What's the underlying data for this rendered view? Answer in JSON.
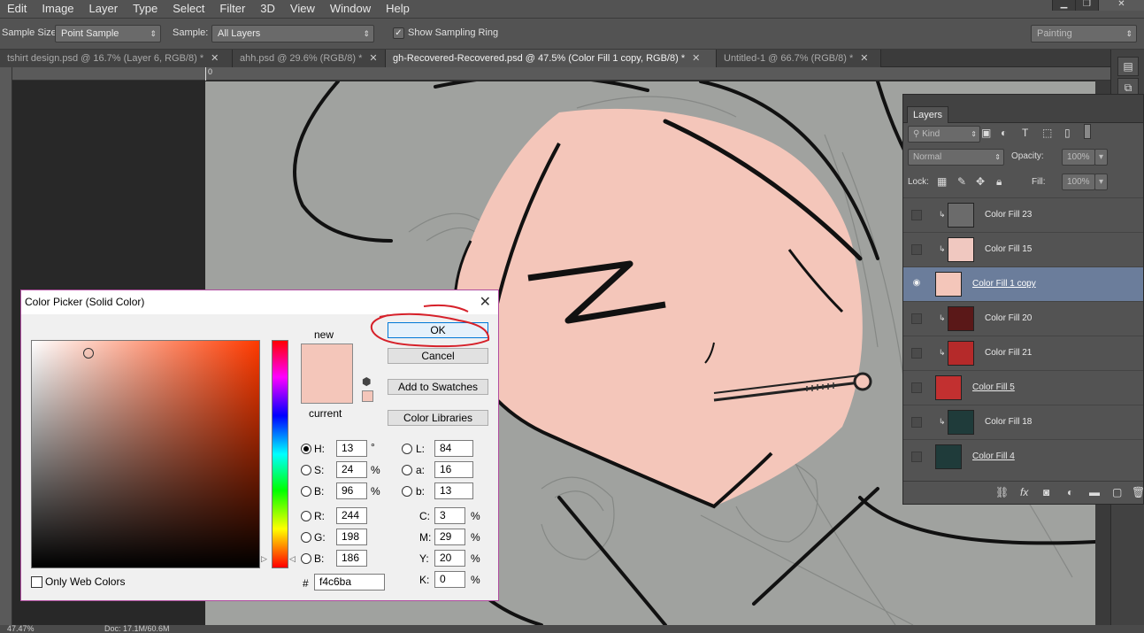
{
  "menu": [
    "Edit",
    "Image",
    "Layer",
    "Type",
    "Select",
    "Filter",
    "3D",
    "View",
    "Window",
    "Help"
  ],
  "options": {
    "sample_size_label": "Sample Size:",
    "sample_size_value": "Point Sample",
    "sample_label": "Sample:",
    "sample_value": "All Layers",
    "show_ring_label": "Show Sampling Ring",
    "workspace_value": "Painting"
  },
  "tabs": [
    "tshirt design.psd @ 16.7% (Layer 6, RGB/8) *",
    "ahh.psd @ 29.6% (RGB/8) *",
    "gh-Recovered-Recovered.psd @ 47.5% (Color Fill 1 copy, RGB/8) *",
    "Untitled-1 @ 66.7% (RGB/8) *"
  ],
  "ruler": {
    "zero": "0"
  },
  "status": {
    "zoom": "47.47%",
    "doc": "Doc: 17.1M/60.6M"
  },
  "layers_panel": {
    "tab": "Layers",
    "filter_kind": "Kind",
    "blend_mode": "Normal",
    "opacity_label": "Opacity:",
    "opacity_value": "100%",
    "lock_label": "Lock:",
    "fill_label": "Fill:",
    "fill_value": "100%",
    "layers": [
      {
        "name": "Color Fill 23",
        "visible": false,
        "clipped": true,
        "active": false,
        "thumb": "#6b6b6b"
      },
      {
        "name": "Color Fill 15",
        "visible": false,
        "clipped": true,
        "active": false,
        "thumb": "#f0c8c0"
      },
      {
        "name": "Color Fill 1 copy",
        "visible": true,
        "clipped": false,
        "active": true,
        "thumb": "#f4c6ba"
      },
      {
        "name": "Color Fill 20",
        "visible": false,
        "clipped": true,
        "active": false,
        "thumb": "#5a1818"
      },
      {
        "name": "Color Fill 21",
        "visible": false,
        "clipped": true,
        "active": false,
        "thumb": "#b52a2a"
      },
      {
        "name": "Color Fill 5",
        "visible": false,
        "clipped": false,
        "active": false,
        "thumb": "#c23030"
      },
      {
        "name": "Color Fill 18",
        "visible": false,
        "clipped": true,
        "active": false,
        "thumb": "#1f3b3a"
      },
      {
        "name": "Color Fill 4",
        "visible": false,
        "clipped": false,
        "active": false,
        "thumb": "#1f3b3a"
      }
    ]
  },
  "color_picker": {
    "title": "Color Picker (Solid Color)",
    "new_label": "new",
    "current_label": "current",
    "ok": "OK",
    "cancel": "Cancel",
    "add_swatches": "Add to Swatches",
    "color_libraries": "Color Libraries",
    "only_web_colors": "Only Web Colors",
    "hex_label": "#",
    "hex": "f4c6ba",
    "color": "#f4c6ba",
    "hsb": {
      "H": "13",
      "S": "24",
      "B": "96"
    },
    "rgb": {
      "R": "244",
      "G": "198",
      "B": "186"
    },
    "lab": {
      "L": "84",
      "a": "16",
      "b": "13"
    },
    "cmyk": {
      "C": "3",
      "M": "29",
      "Y": "20",
      "K": "0"
    },
    "units": {
      "deg": "°",
      "pct": "%"
    }
  }
}
